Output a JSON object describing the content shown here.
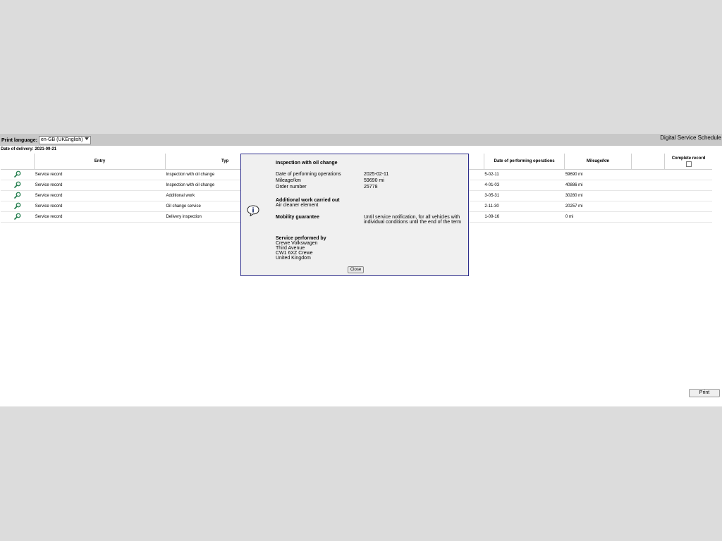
{
  "header": {
    "print_language_label": "Print language:",
    "print_language_value": "en-GB (UKEnglish)",
    "app_title": "Digital Service Schedule"
  },
  "delivery": {
    "text": "Date of delivery: 2021-09-21"
  },
  "table": {
    "columns": {
      "entry": "Entry",
      "type": "Typ",
      "date": "Date of performing operations",
      "mileage": "Mileage/km",
      "complete": "Complete record"
    },
    "rows": [
      {
        "entry": "Service record",
        "type": "Inspection with oil change",
        "date": "5-02-11",
        "mileage": "59690 mi"
      },
      {
        "entry": "Service record",
        "type": "Inspection with oil change",
        "date": "4-01-03",
        "mileage": "40886 mi"
      },
      {
        "entry": "Service record",
        "type": "Additional work",
        "date": "3-05-31",
        "mileage": "30280 mi"
      },
      {
        "entry": "Service record",
        "type": "Oil change service",
        "date": "2-11-30",
        "mileage": "20257 mi"
      },
      {
        "entry": "Service record",
        "type": "Delivery inspection",
        "date": "1-09-16",
        "mileage": "0 mi"
      }
    ]
  },
  "print_button": "Print",
  "dialog": {
    "title": "Inspection with oil change",
    "date_label": "Date of performing operations",
    "date_value": "2025-02-11",
    "mileage_label": "Mileage/km",
    "mileage_value": "59690 mi",
    "order_label": "Order number",
    "order_value": "25778",
    "additional_heading": "Additional work carried out",
    "additional_item": "Air cleaner element",
    "mobility_label": "Mobility guarantee",
    "mobility_value": "Until service notification, for all vehicles with individual conditions until the end of the term",
    "performed_heading": "Service performed by",
    "performed_lines": [
      "Crewe Volkswagen",
      "Third Avenue",
      "CW1 6XZ Crewe",
      "United Kingdom"
    ],
    "close_label": "Close"
  },
  "icons": {
    "row_icon": "magnifier-icon",
    "dialog_icon": "info-icon"
  }
}
